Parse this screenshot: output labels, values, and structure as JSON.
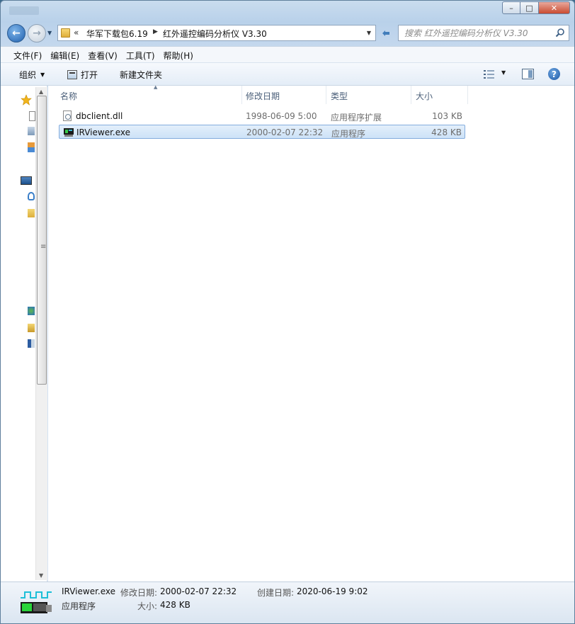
{
  "window": {
    "controls": {
      "minimize": "–",
      "maximize": "□",
      "close": "✕"
    }
  },
  "address": {
    "overflow": "«",
    "breadcrumbs": [
      "华军下载包6.19",
      "红外遥控编码分析仪 V3.30"
    ]
  },
  "search": {
    "placeholder": "搜索 红外遥控编码分析仪 V3.30"
  },
  "menu": [
    "文件(F)",
    "编辑(E)",
    "查看(V)",
    "工具(T)",
    "帮助(H)"
  ],
  "toolbar": {
    "organize": "组织",
    "open": "打开",
    "new_folder": "新建文件夹",
    "help": "?"
  },
  "columns": {
    "name": "名称",
    "date": "修改日期",
    "type": "类型",
    "size": "大小"
  },
  "files": [
    {
      "name": "dbclient.dll",
      "date": "1998-06-09 5:00",
      "type": "应用程序扩展",
      "size": "103 KB",
      "icon": "dll-file-icon",
      "selected": false
    },
    {
      "name": "IRViewer.exe",
      "date": "2000-02-07 22:32",
      "type": "应用程序",
      "size": "428 KB",
      "icon": "exe-file-icon",
      "selected": true
    }
  ],
  "details": {
    "name": "IRViewer.exe",
    "type": "应用程序",
    "modified_label": "修改日期:",
    "modified": "2000-02-07 22:32",
    "size_label": "大小:",
    "size": "428 KB",
    "created_label": "创建日期:",
    "created": "2020-06-19 9:02"
  },
  "colors": {
    "selection": "#cde2f7",
    "selection_border": "#84acdd",
    "header_text": "#4c607a",
    "secondary_text": "#6d6d6d"
  }
}
